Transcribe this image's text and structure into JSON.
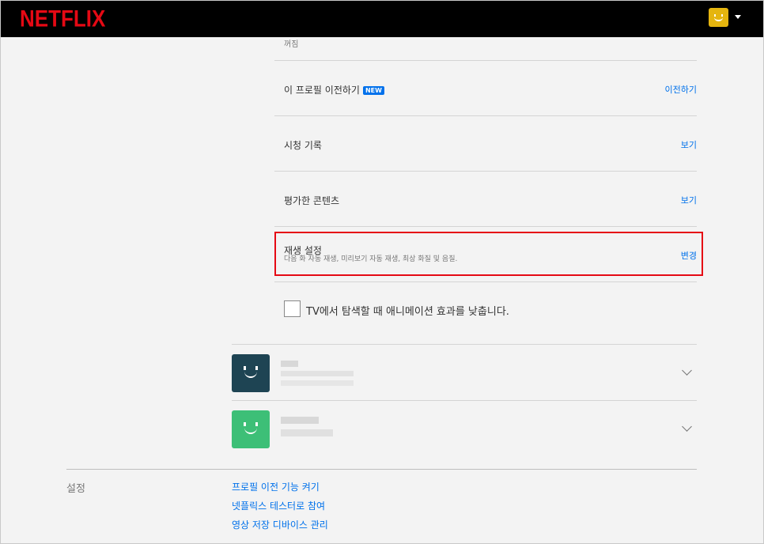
{
  "header": {
    "logo": "NETFLIX",
    "brand_color": "#e50914",
    "avatar_color": "#e5b50f"
  },
  "partial_row": {
    "subtext": "꺼짐"
  },
  "rows": [
    {
      "label": "이 프로필 이전하기",
      "badge": "NEW",
      "action": "이전하기"
    },
    {
      "label": "시청 기록",
      "action": "보기"
    },
    {
      "label": "평가한 콘텐츠",
      "action": "보기"
    },
    {
      "label": "재생 설정",
      "sub": "다음 화 자동 재생, 미리보기 자동 재생, 최상 화질 및 음질.",
      "action": "변경"
    }
  ],
  "checkbox": {
    "label": "TV에서 탐색할 때 애니메이션 효과를 낮춥니다.",
    "checked": false
  },
  "profiles": [
    {
      "avatar_color": "#1e4453",
      "icon": "smile-icon"
    },
    {
      "avatar_color": "#3dbf77",
      "icon": "smile-icon"
    }
  ],
  "settings": {
    "title": "설정",
    "links": [
      "프로필 이전 기능 켜기",
      "넷플릭스 테스터로 참여",
      "영상 저장 디바이스 관리"
    ]
  }
}
